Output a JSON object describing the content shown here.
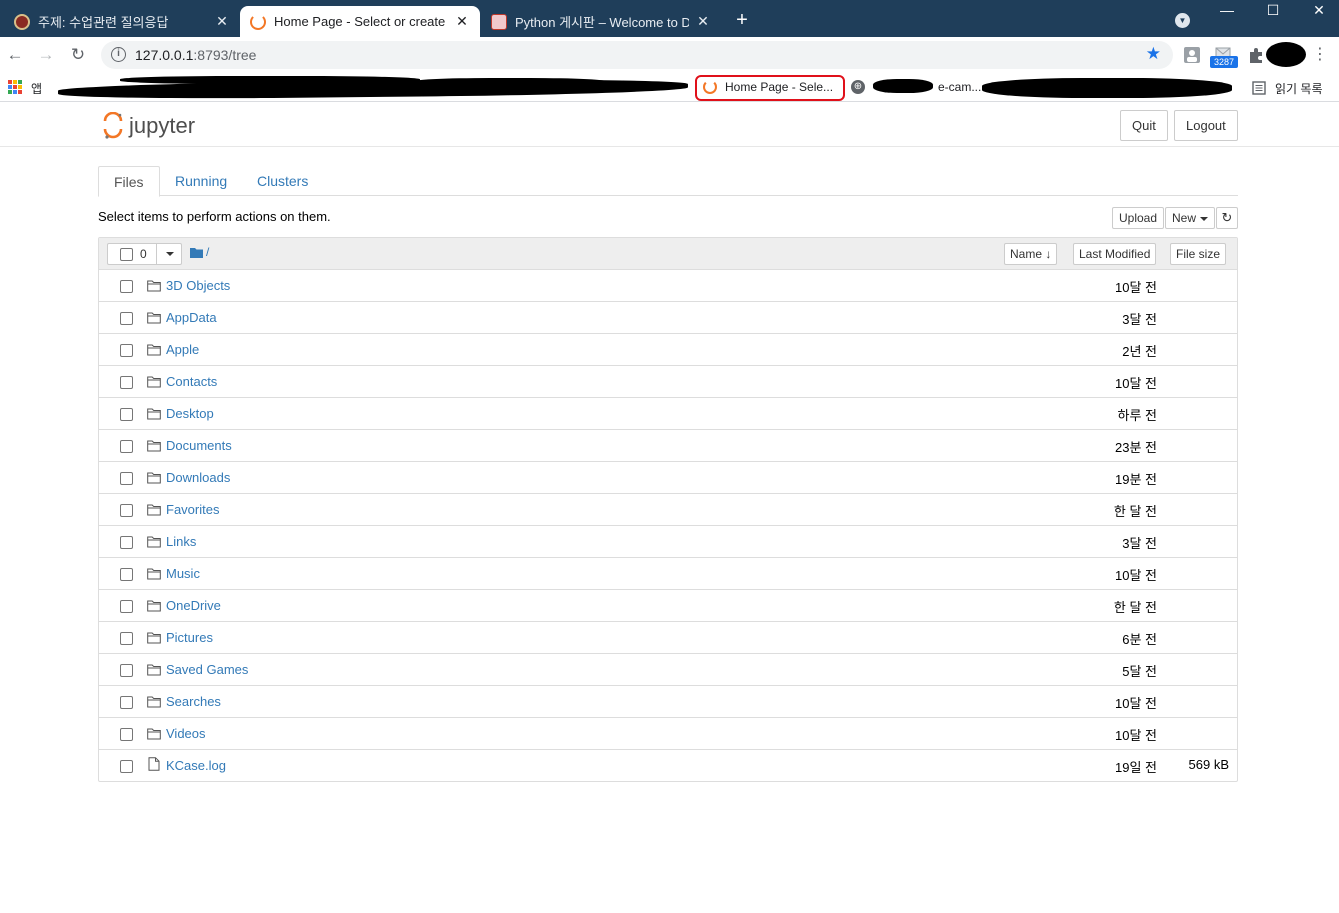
{
  "browser": {
    "tabs": [
      {
        "title": "주제: 수업관련 질의응답",
        "active": false,
        "close": "✕"
      },
      {
        "title": "Home Page - Select or create a",
        "active": true,
        "close": "✕"
      },
      {
        "title": "Python 게시판 – Welcome to Dr",
        "active": false,
        "close": "✕"
      }
    ],
    "new_tab": "+",
    "url_host": "127.0.0.1",
    "url_rest": ":8793/tree",
    "extension_badge": "3287",
    "bookmarks": {
      "apps_label": "앱",
      "highlighted": "Home Page - Sele...",
      "ecampus": "e-cam...",
      "reading_list": "읽기 목록"
    }
  },
  "jupyter": {
    "logo_text": "jupyter",
    "quit_label": "Quit",
    "logout_label": "Logout",
    "tabs": [
      "Files",
      "Running",
      "Clusters"
    ],
    "hint": "Select items to perform actions on them.",
    "upload_label": "Upload",
    "new_label": "New",
    "selected_count": "0",
    "breadcrumb_sep": "/",
    "columns": {
      "name": "Name",
      "last_modified": "Last Modified",
      "file_size": "File size"
    },
    "files": [
      {
        "name": "3D Objects",
        "type": "folder",
        "modified": "10달 전",
        "size": ""
      },
      {
        "name": "AppData",
        "type": "folder",
        "modified": "3달 전",
        "size": ""
      },
      {
        "name": "Apple",
        "type": "folder",
        "modified": "2년 전",
        "size": ""
      },
      {
        "name": "Contacts",
        "type": "folder",
        "modified": "10달 전",
        "size": ""
      },
      {
        "name": "Desktop",
        "type": "folder",
        "modified": "하루 전",
        "size": ""
      },
      {
        "name": "Documents",
        "type": "folder",
        "modified": "23분 전",
        "size": ""
      },
      {
        "name": "Downloads",
        "type": "folder",
        "modified": "19분 전",
        "size": ""
      },
      {
        "name": "Favorites",
        "type": "folder",
        "modified": "한 달 전",
        "size": ""
      },
      {
        "name": "Links",
        "type": "folder",
        "modified": "3달 전",
        "size": ""
      },
      {
        "name": "Music",
        "type": "folder",
        "modified": "10달 전",
        "size": ""
      },
      {
        "name": "OneDrive",
        "type": "folder",
        "modified": "한 달 전",
        "size": ""
      },
      {
        "name": "Pictures",
        "type": "folder",
        "modified": "6분 전",
        "size": ""
      },
      {
        "name": "Saved Games",
        "type": "folder",
        "modified": "5달 전",
        "size": ""
      },
      {
        "name": "Searches",
        "type": "folder",
        "modified": "10달 전",
        "size": ""
      },
      {
        "name": "Videos",
        "type": "folder",
        "modified": "10달 전",
        "size": ""
      },
      {
        "name": "KCase.log",
        "type": "file",
        "modified": "19일 전",
        "size": "569 kB"
      }
    ]
  },
  "colors": {
    "tabstrip": "#1f3e5a",
    "link": "#337ab7",
    "jupyter_orange": "#f37726",
    "highlight_red": "#e0101a"
  }
}
